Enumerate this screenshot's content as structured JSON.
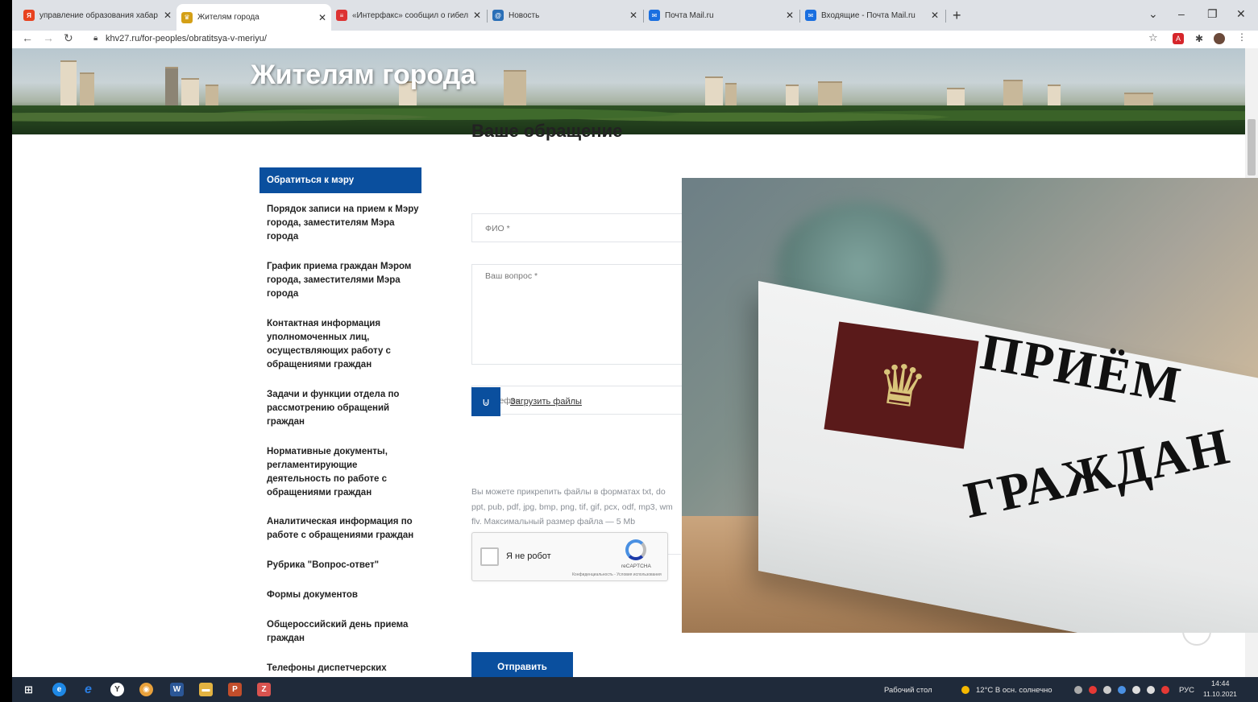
{
  "browser": {
    "tabs": [
      {
        "title": "управление образования хабар",
        "favicon_color": "#e8421f",
        "favicon_glyph": "Я"
      },
      {
        "title": "Жителям города",
        "favicon_color": "#d4a017",
        "favicon_glyph": "♛"
      },
      {
        "title": "«Интерфакс» сообщил о гибел",
        "favicon_color": "#d33",
        "favicon_glyph": "≡"
      },
      {
        "title": "Новость",
        "favicon_color": "#2a6fb7",
        "favicon_glyph": "@"
      },
      {
        "title": "Почта Mail.ru",
        "favicon_color": "#1a6fe0",
        "favicon_glyph": "✉"
      },
      {
        "title": "Входящие - Почта Mail.ru",
        "favicon_color": "#1a6fe0",
        "favicon_glyph": "✉"
      }
    ],
    "new_tab": "+",
    "url": "khv27.ru/for-peoples/obratitsya-v-meriyu/"
  },
  "banner": {
    "title": "Жителям города"
  },
  "sidebar": {
    "items": [
      "Обратиться к мэру",
      "Порядок записи на прием к Мэру города, заместителям Мэра города",
      "График приема граждан Мэром города, заместителями Мэра города",
      "Контактная информация уполномоченных лиц, осуществляющих работу с обращениями граждан",
      "Задачи и функции отдела по рассмотрению обращений граждан",
      "Нормативные документы, регламентирующие деятельность по работе с обращениями граждан",
      "Аналитическая информация по работе с обращениями граждан",
      "Рубрика \"Вопрос-ответ\"",
      "Формы документов",
      "Общероссийский день приема граждан",
      "Телефоны диспетчерских"
    ]
  },
  "form": {
    "title": "Ваше обращение",
    "name_placeholder": "ФИО *",
    "question_placeholder": "Ваш вопрос *",
    "phone_placeholder": "Телефон",
    "upload_label": "Загрузить файлы",
    "hint_lines": [
      "Вы можете прикрепить файлы в форматах txt, do",
      "ppt, pub, pdf, jpg, bmp, png, tif, gif, pcx, odf, mp3, wm",
      "flv. Максимальный размер файла — 5 Mb"
    ],
    "captcha_label": "Я не робот",
    "captcha_brand": "reCAPTCHA",
    "captcha_terms": "Конфиденциальность - Условия использования",
    "submit_label": "Отправить"
  },
  "overlay": {
    "line1": "ПРИЁМ",
    "line2": "ГРАЖДАН"
  },
  "taskbar": {
    "desktop_label": "Рабочий стол",
    "weather": "12°C В осн. солнечно",
    "lang": "РУС",
    "time": "14:44",
    "date": "11.10.2021"
  },
  "colors": {
    "accent": "#0a4f9e",
    "taskbar": "#1f2a3a"
  }
}
